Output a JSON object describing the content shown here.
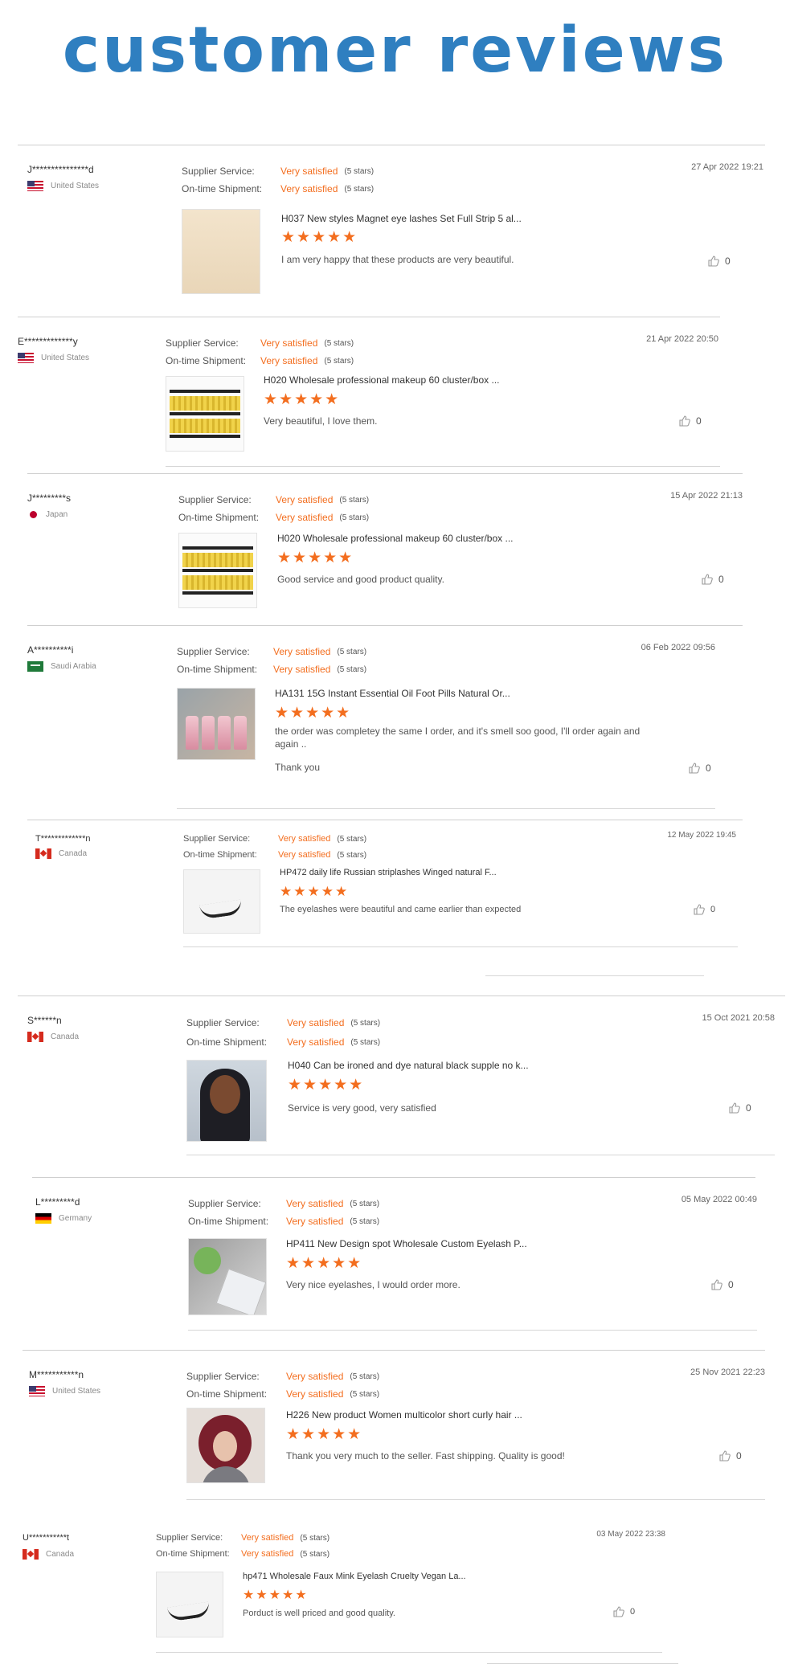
{
  "title": "customer reviews",
  "labels": {
    "supplier_service": "Supplier Service:",
    "on_time_shipment": "On-time Shipment:"
  },
  "colors": {
    "accent": "#f36e1f",
    "title": "#2f7fc0"
  },
  "reviews": [
    {
      "name": "J***************d",
      "country": "United States",
      "flag": "us",
      "supplier_value": "Very satisfied",
      "supplier_stars": "(5 stars)",
      "shipment_value": "Very satisfied",
      "shipment_stars": "(5 stars)",
      "date": "27 Apr 2022 19:21",
      "product": "H037 New styles Magnet eye lashes Set Full Strip 5 al...",
      "rating": 5,
      "stars_text": "★★★★★",
      "comment": "I am very happy that these products are very beautiful.",
      "likes": "0"
    },
    {
      "name": "E*************y",
      "country": "United States",
      "flag": "us",
      "supplier_value": "Very satisfied",
      "supplier_stars": "(5 stars)",
      "shipment_value": "Very satisfied",
      "shipment_stars": "(5 stars)",
      "date": "21 Apr 2022 20:50",
      "product": "H020 Wholesale professional makeup 60 cluster/box ...",
      "rating": 5,
      "stars_text": "★★★★★",
      "comment": "Very beautiful, I love them.",
      "likes": "0"
    },
    {
      "name": "J*********s",
      "country": "Japan",
      "flag": "jp",
      "supplier_value": "Very satisfied",
      "supplier_stars": "(5 stars)",
      "shipment_value": "Very satisfied",
      "shipment_stars": "(5 stars)",
      "date": "15 Apr 2022 21:13",
      "product": "H020 Wholesale professional makeup 60 cluster/box ...",
      "rating": 5,
      "stars_text": "★★★★★",
      "comment": "Good service and good product quality.",
      "likes": "0"
    },
    {
      "name": "A**********i",
      "country": "Saudi Arabia",
      "flag": "sa",
      "supplier_value": "Very satisfied",
      "supplier_stars": "(5 stars)",
      "shipment_value": "Very satisfied",
      "shipment_stars": "(5 stars)",
      "date": "06 Feb 2022 09:56",
      "product": "HA131 15G Instant Essential Oil Foot Pills Natural Or...",
      "rating": 5,
      "stars_text": "★★★★★",
      "comment": "the order was completey the same I order, and it's smell soo good, I'll order again and again ..",
      "extra": "Thank you",
      "likes": "0"
    },
    {
      "name": "T*************n",
      "country": "Canada",
      "flag": "ca",
      "supplier_value": "Very satisfied",
      "supplier_stars": "(5 stars)",
      "shipment_value": "Very satisfied",
      "shipment_stars": "(5 stars)",
      "date": "12 May 2022 19:45",
      "product": "HP472 daily life Russian striplashes Winged natural F...",
      "rating": 5,
      "stars_text": "★★★★★",
      "comment": "The eyelashes were beautiful and came earlier than expected",
      "likes": "0"
    },
    {
      "name": "S******n",
      "country": "Canada",
      "flag": "ca",
      "supplier_value": "Very satisfied",
      "supplier_stars": "(5 stars)",
      "shipment_value": "Very satisfied",
      "shipment_stars": "(5 stars)",
      "date": "15 Oct 2021 20:58",
      "product": "H040 Can be ironed and dye natural black supple no k...",
      "rating": 5,
      "stars_text": "★★★★★",
      "comment": "Service is very good, very satisfied",
      "likes": "0"
    },
    {
      "name": "L*********d",
      "country": "Germany",
      "flag": "de",
      "supplier_value": "Very satisfied",
      "supplier_stars": "(5 stars)",
      "shipment_value": "Very satisfied",
      "shipment_stars": "(5 stars)",
      "date": "05 May 2022 00:49",
      "product": "HP411 New Design spot Wholesale Custom Eyelash P...",
      "rating": 5,
      "stars_text": "★★★★★",
      "comment": "Very nice eyelashes, I would order more.",
      "likes": "0"
    },
    {
      "name": "M***********n",
      "country": "United States",
      "flag": "us",
      "supplier_value": "Very satisfied",
      "supplier_stars": "(5 stars)",
      "shipment_value": "Very satisfied",
      "shipment_stars": "(5 stars)",
      "date": "25 Nov 2021 22:23",
      "product": "H226 New product Women multicolor short curly hair ...",
      "rating": 5,
      "stars_text": "★★★★★",
      "comment": "Thank you very much to the seller. Fast shipping. Quality is good!",
      "likes": "0"
    },
    {
      "name": "U***********t",
      "country": "Canada",
      "flag": "ca",
      "supplier_value": "Very satisfied",
      "supplier_stars": "(5 stars)",
      "shipment_value": "Very satisfied",
      "shipment_stars": "(5 stars)",
      "date": "03 May 2022 23:38",
      "product": "hp471 Wholesale Faux Mink Eyelash Cruelty Vegan La...",
      "rating": 5,
      "stars_text": "★★★★★",
      "comment": "Porduct is well priced and good quality.",
      "likes": "0"
    }
  ]
}
